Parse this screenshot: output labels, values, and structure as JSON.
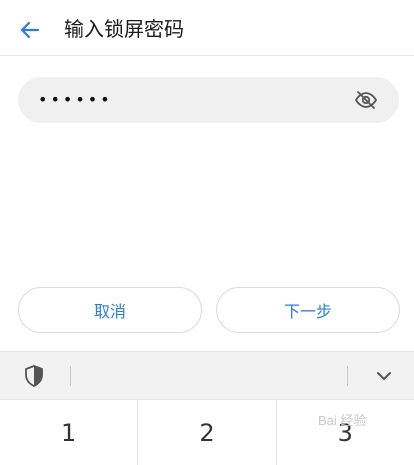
{
  "header": {
    "title": "输入锁屏密码",
    "back_icon": "arrow-left-icon"
  },
  "password_field": {
    "value": "••••••",
    "toggle_icon": "eye-off-icon"
  },
  "buttons": {
    "cancel_label": "取消",
    "next_label": "下一步"
  },
  "keyboard": {
    "toolbar": {
      "shield_icon": "shield-icon",
      "collapse_icon": "chevron-down-icon"
    },
    "keys": [
      "1",
      "2",
      "3"
    ]
  },
  "watermark": {
    "text": "Bai 经验"
  },
  "colors": {
    "accent": "#2a7de1",
    "field_bg": "#f0f0f0",
    "toolbar_bg": "#f2f2f2"
  }
}
